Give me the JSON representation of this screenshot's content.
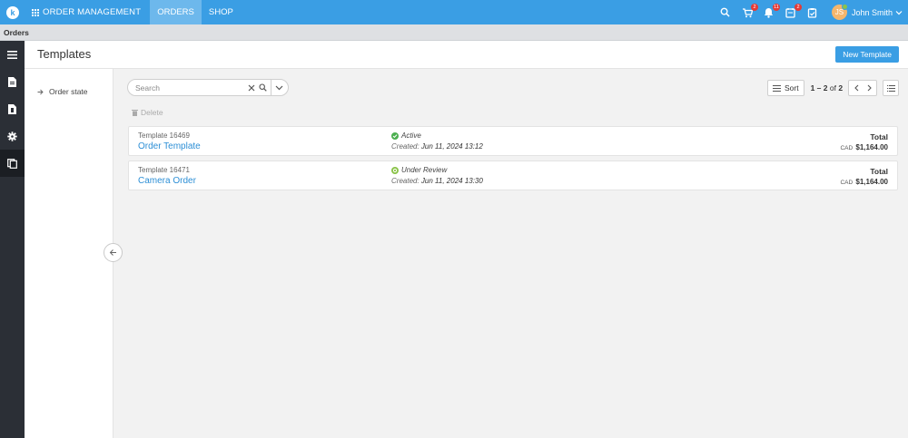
{
  "topbar": {
    "logo_letter": "k",
    "app_name": "ORDER MANAGEMENT",
    "tabs": [
      {
        "label": "ORDERS",
        "active": true
      },
      {
        "label": "SHOP",
        "active": false
      }
    ],
    "cart_badge": "2",
    "bell_badge": "11",
    "tasks_badge": "2",
    "avatar_initial": "JS",
    "user_name": "John Smith"
  },
  "subheader": {
    "section": "Orders"
  },
  "sidebar": {
    "items": [
      {
        "icon": "hamburger-menu-icon"
      },
      {
        "icon": "document-icon"
      },
      {
        "icon": "file-icon"
      },
      {
        "icon": "gear-icon"
      },
      {
        "icon": "templates-icon",
        "active": true
      }
    ]
  },
  "header": {
    "title": "Templates",
    "new_button": "New Template"
  },
  "filters": {
    "items": [
      {
        "label": "Order state"
      }
    ]
  },
  "toolbar": {
    "search_placeholder": "Search",
    "delete_label": "Delete",
    "sort_label": "Sort",
    "page_range": "1 – 2",
    "page_of": " of ",
    "page_total": "2"
  },
  "templates": [
    {
      "id_label": "Template 16469",
      "name": "Order Template",
      "status": "Active",
      "status_color": "#4caf50",
      "created_label": "Created:",
      "created_date": "Jun 11, 2024 13:12",
      "total_label": "Total",
      "currency": "CAD",
      "amount": "$1,164.00"
    },
    {
      "id_label": "Template 16471",
      "name": "Camera Order",
      "status": "Under Review",
      "status_color": "#8bc34a",
      "created_label": "Created:",
      "created_date": "Jun 11, 2024 13:30",
      "total_label": "Total",
      "currency": "CAD",
      "amount": "$1,164.00"
    }
  ],
  "colors": {
    "primary": "#3a9ee4",
    "active_tab": "#6db8ec",
    "sidebar_bg": "#2b2f36",
    "link": "#2d8fd6",
    "badge": "#e53935"
  }
}
